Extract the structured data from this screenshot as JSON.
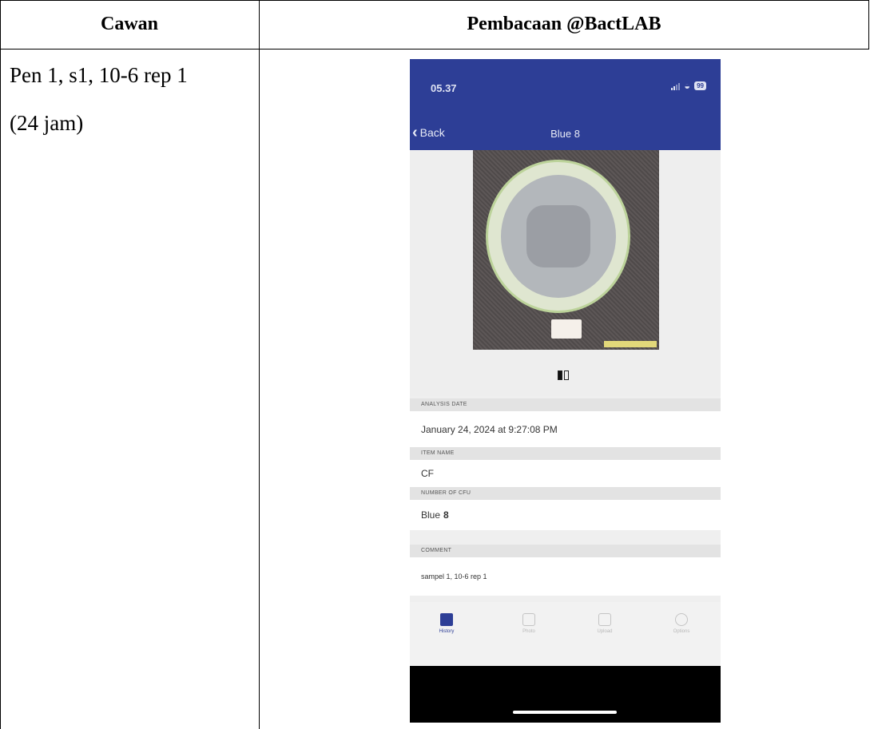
{
  "table": {
    "header_left": "Cawan",
    "header_right": "Pembacaan @BactLAB",
    "cell_left_line1": "Pen 1, s1, 10-6 rep 1",
    "cell_left_line2": "(24 jam)"
  },
  "phone": {
    "status_time": "05.37",
    "battery": "99",
    "back_label": "Back",
    "nav_title": "Blue 8",
    "sections": {
      "analysis_date_label": "ANALYSIS DATE",
      "analysis_date_value": "January 24, 2024 at 9:27:08 PM",
      "item_name_label": "ITEM NAME",
      "item_name_value": "CF",
      "cfu_label": "NUMBER OF CFU",
      "cfu_color": "Blue",
      "cfu_count": "8",
      "comment_label": "COMMENT",
      "comment_value": "sampel 1, 10-6 rep 1"
    },
    "tabs": [
      {
        "label": "History",
        "icon": "history-icon"
      },
      {
        "label": "Photo",
        "icon": "camera-icon"
      },
      {
        "label": "Upload",
        "icon": "upload-icon"
      },
      {
        "label": "Options",
        "icon": "gear-icon"
      }
    ],
    "colors": {
      "nav": "#2d3e96",
      "accent": "#2d3e96"
    }
  }
}
